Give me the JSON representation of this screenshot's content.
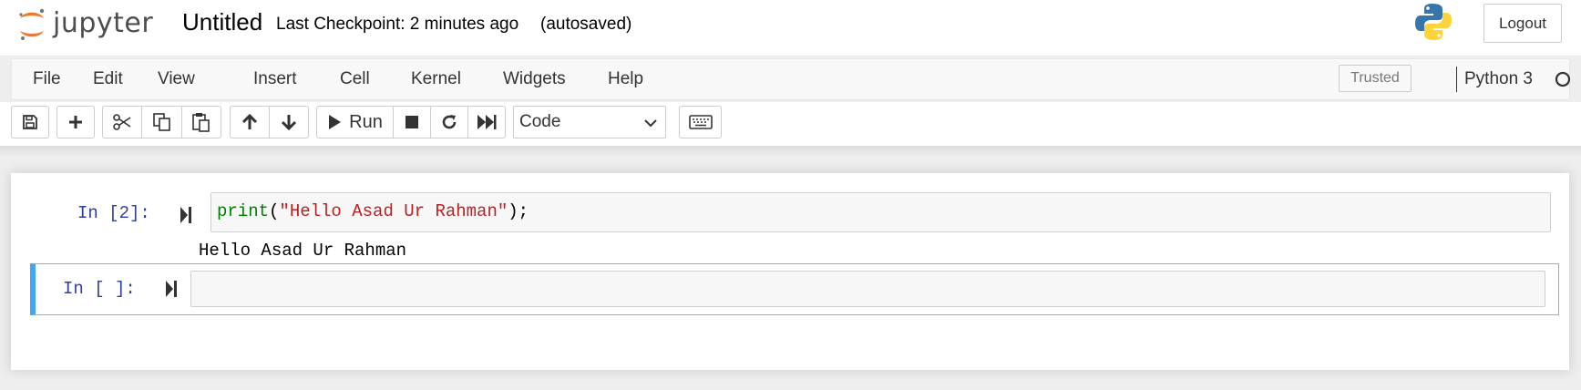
{
  "header": {
    "logo_text": "jupyter",
    "notebook_title": "Untitled",
    "checkpoint": "Last Checkpoint: 2 minutes ago",
    "autosave_status": "(autosaved)",
    "logout_label": "Logout",
    "kernel_logo_icon": "python-logo-icon"
  },
  "menubar": {
    "items": [
      "File",
      "Edit",
      "View",
      "Insert",
      "Cell",
      "Kernel",
      "Widgets",
      "Help"
    ],
    "trusted_label": "Trusted",
    "kernel_name": "Python 3",
    "kernel_status_icon": "kernel-idle-circle-icon"
  },
  "toolbar": {
    "buttons": [
      "save-icon",
      "plus-icon",
      "cut-icon",
      "copy-icon",
      "paste-icon",
      "arrow-up-icon",
      "arrow-down-icon",
      "run-icon",
      "stop-icon",
      "restart-icon",
      "fast-forward-icon",
      "keyboard-icon"
    ],
    "run_label": "Run",
    "cell_type_selected": "Code"
  },
  "cells": [
    {
      "prompt": "In [2]:",
      "code_builtin": "print",
      "code_open": "(",
      "code_string": "\"Hello Asad Ur Rahman\"",
      "code_close": ");",
      "output": "Hello Asad Ur Rahman"
    },
    {
      "prompt": "In [ ]:",
      "code": ""
    }
  ],
  "colors": {
    "prompt_in": "#303f9f",
    "selected_cell_border": "#42a5f5",
    "builtin": "#008000",
    "string": "#ba2121",
    "jupyter_orange": "#f37726"
  }
}
